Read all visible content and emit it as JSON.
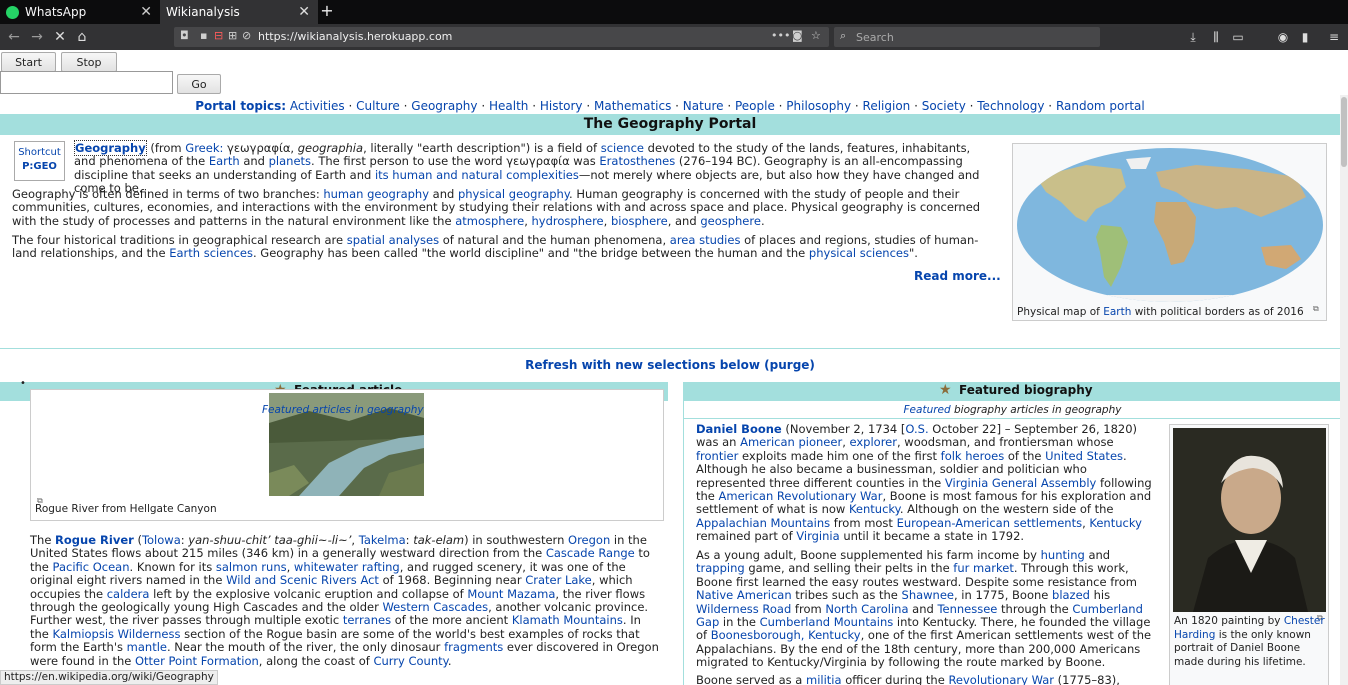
{
  "browser": {
    "tabs": [
      {
        "label": "WhatsApp"
      },
      {
        "label": "Wikianalysis"
      }
    ],
    "url": "https://wikianalysis.herokuapp.com",
    "search_placeholder": "Search",
    "status_url": "https://en.wikipedia.org/wiki/Geography"
  },
  "controls": {
    "start_label": "Start",
    "stop_label": "Stop",
    "go_label": "Go",
    "input_value": ""
  },
  "portal": {
    "label": "Portal topics:",
    "topics": [
      "Activities",
      "Culture",
      "Geography",
      "Health",
      "History",
      "Mathematics",
      "Nature",
      "People",
      "Philosophy",
      "Religion",
      "Society",
      "Technology",
      "Random portal"
    ],
    "title": "The Geography Portal",
    "shortcut_label": "Shortcut",
    "shortcut_code": "P:GEO",
    "read_more": "Read more...",
    "purge": "Refresh with new selections below (purge)",
    "map_caption_a": "Physical map of ",
    "map_caption_link": "Earth",
    "map_caption_b": " with political borders as of 2016"
  },
  "featured_article": {
    "header": "Featured article",
    "sub": "Featured articles in geography",
    "image_caption": "Rogue River from Hellgate Canyon"
  },
  "featured_biography": {
    "header": "Featured biography",
    "sub_link": "Featured",
    "sub_rest": " biography articles in geography",
    "caption_a": "An 1820 painting by ",
    "caption_link": "Chester Harding",
    "caption_b": " is the only known portrait of Daniel Boone made during his lifetime."
  },
  "colors": {
    "header_teal": "#a3dfdd",
    "link_blue": "#0645ad",
    "tab_bar": "#0c0c0d",
    "nav_bar": "#323234"
  }
}
